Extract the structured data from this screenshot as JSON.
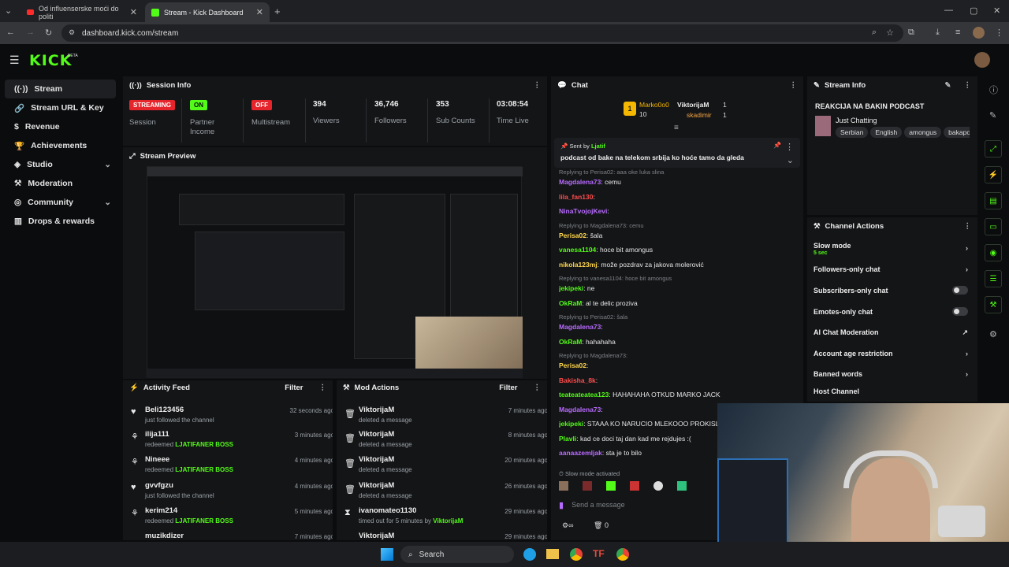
{
  "browser": {
    "tabs": [
      {
        "label": "Od influenserske moći do politi"
      },
      {
        "label": "Stream - Kick Dashboard"
      }
    ],
    "url": "dashboard.kick.com/stream"
  },
  "brand": {
    "logo": "KICK",
    "beta": "BETA",
    "accent": "#53fc18"
  },
  "sidebar": {
    "items": [
      {
        "label": "Stream",
        "icon": "broadcast-icon"
      },
      {
        "label": "Stream URL & Key",
        "icon": "link-icon"
      },
      {
        "label": "Revenue",
        "icon": "dollar-icon"
      },
      {
        "label": "Achievements",
        "icon": "trophy-icon"
      },
      {
        "label": "Studio",
        "icon": "layers-icon"
      },
      {
        "label": "Moderation",
        "icon": "hammer-icon"
      },
      {
        "label": "Community",
        "icon": "globe-icon"
      },
      {
        "label": "Drops & rewards",
        "icon": "chart-icon"
      }
    ]
  },
  "session": {
    "title": "Session Info",
    "stats": [
      {
        "badge": "STREAMING",
        "label": "Session"
      },
      {
        "badge": "ON",
        "label": "Partner Income"
      },
      {
        "badge": "OFF",
        "label": "Multistream"
      },
      {
        "value": "394",
        "label": "Viewers"
      },
      {
        "value": "36,746",
        "label": "Followers"
      },
      {
        "value": "353",
        "label": "Sub Counts"
      },
      {
        "value": "03:08:54",
        "label": "Time Live"
      }
    ]
  },
  "preview": {
    "title": "Stream Preview"
  },
  "activity": {
    "title": "Activity Feed",
    "filter": "Filter",
    "items": [
      {
        "name": "Beli123456",
        "sub": "just followed the channel",
        "reward": "",
        "time": "32 seconds ago"
      },
      {
        "name": "ilija111",
        "sub": "redeemed",
        "reward": "LJATIFANER BOSS",
        "time": "3 minutes ago"
      },
      {
        "name": "Nineee",
        "sub": "redeemed",
        "reward": "LJATIFANER BOSS",
        "time": "4 minutes ago"
      },
      {
        "name": "gvvfgzu",
        "sub": "just followed the channel",
        "reward": "",
        "time": "4 minutes ago"
      },
      {
        "name": "kerim214",
        "sub": "redeemed",
        "reward": "LJATIFANER BOSS",
        "time": "5 minutes ago"
      },
      {
        "name": "muzikdizer",
        "sub": "",
        "reward": "",
        "time": "7 minutes ago"
      }
    ]
  },
  "mod": {
    "title": "Mod Actions",
    "filter": "Filter",
    "items": [
      {
        "name": "ViktorijaM",
        "sub": "deleted a message",
        "by": "",
        "time": "7 minutes ago"
      },
      {
        "name": "ViktorijaM",
        "sub": "deleted a message",
        "by": "",
        "time": "8 minutes ago"
      },
      {
        "name": "ViktorijaM",
        "sub": "deleted a message",
        "by": "",
        "time": "20 minutes ago"
      },
      {
        "name": "ViktorijaM",
        "sub": "deleted a message",
        "by": "",
        "time": "26 minutes ago"
      },
      {
        "name": "ivanomateo1130",
        "sub": "timed out for 5 minutes by",
        "by": "ViktorijaM",
        "time": "29 minutes ago"
      },
      {
        "name": "ViktorijaM",
        "sub": "",
        "by": "",
        "time": "29 minutes ago"
      }
    ]
  },
  "chat": {
    "title": "Chat",
    "top": [
      {
        "name": "Marko0o0",
        "count": "10"
      },
      {
        "name": "ViktorijaM",
        "count": "1"
      },
      {
        "name": "skadimir",
        "count": "1"
      }
    ],
    "pinned": {
      "sent_by": "Sent by",
      "user": "Ljatif",
      "text": "podcast od bake na telekom srbija ko hoće tamo da gleda"
    },
    "messages": [
      {
        "reply": "Replying to Perisa02: aaa oke luka slina"
      },
      {
        "user": "Magdalena73",
        "color": "#b86bff",
        "text": "cemu"
      },
      {
        "user": "lila_fan130",
        "color": "#ff4d4d",
        "text": ""
      },
      {
        "user": "NinaTvojojKevi",
        "color": "#b86bff",
        "text": ""
      },
      {
        "reply": "Replying to Magdalena73: cemu"
      },
      {
        "user": "Perisa02",
        "color": "#ffd84d",
        "text": "šala"
      },
      {
        "user": "vanesa1104",
        "color": "#53fc18",
        "text": "hoce bit amongus"
      },
      {
        "user": "nikola123mj",
        "color": "#ffd84d",
        "text": "može pozdrav za jakova molerović"
      },
      {
        "reply": "Replying to vanesa1104: hoce bit amongus"
      },
      {
        "user": "jekipeki",
        "color": "#53fc18",
        "text": "ne"
      },
      {
        "user": "OkRaM",
        "color": "#53fc18",
        "text": "al te delic proziva"
      },
      {
        "reply": "Replying to Perisa02: šala"
      },
      {
        "user": "Magdalena73",
        "color": "#b86bff",
        "text": ""
      },
      {
        "user": "OkRaM",
        "color": "#53fc18",
        "text": "hahahaha"
      },
      {
        "reply": "Replying to Magdalena73:"
      },
      {
        "user": "Perisa02",
        "color": "#ffd84d",
        "text": ""
      },
      {
        "user": "Bakisha_8k",
        "color": "#ff4d4d",
        "text": ""
      },
      {
        "user": "teateateatea123",
        "color": "#53fc18",
        "text": "HAHAHAHA OTKUD MARKO JACK"
      },
      {
        "user": "Magdalena73",
        "color": "#b86bff",
        "text": ""
      },
      {
        "user": "jekipeki",
        "color": "#53fc18",
        "text": "STAAA KO NARUCIO MLEKOOO PROKISLO"
      },
      {
        "user": "Plavli",
        "color": "#53fc18",
        "text": "kad ce doci taj dan kad me rejdujes :("
      },
      {
        "user": "aanaazemljak",
        "color": "#b86bff",
        "text": "sta je to bilo"
      }
    ],
    "slow_notice": "Slow mode activated",
    "placeholder": "Send a message",
    "count": "0"
  },
  "stream_info": {
    "title": "Stream Info",
    "stream_title": "REAKCIJA NA BAKIN PODCAST",
    "category": "Just Chatting",
    "tags": [
      "Serbian",
      "English",
      "amongus",
      "bakapo"
    ]
  },
  "channel_actions": {
    "title": "Channel Actions",
    "items": [
      {
        "label": "Slow mode",
        "sub": "5 sec",
        "control": "chevron"
      },
      {
        "label": "Followers-only chat",
        "sub": "",
        "control": "chevron"
      },
      {
        "label": "Subscribers-only chat",
        "sub": "",
        "control": "toggle"
      },
      {
        "label": "Emotes-only chat",
        "sub": "",
        "control": "toggle"
      },
      {
        "label": "AI Chat Moderation",
        "sub": "",
        "control": "external"
      },
      {
        "label": "Account age restriction",
        "sub": "",
        "control": "chevron"
      },
      {
        "label": "Banned words",
        "sub": "",
        "control": "chevron"
      },
      {
        "label": "Host Channel",
        "sub": "",
        "control": "none"
      }
    ]
  },
  "taskbar": {
    "search": "Search"
  }
}
